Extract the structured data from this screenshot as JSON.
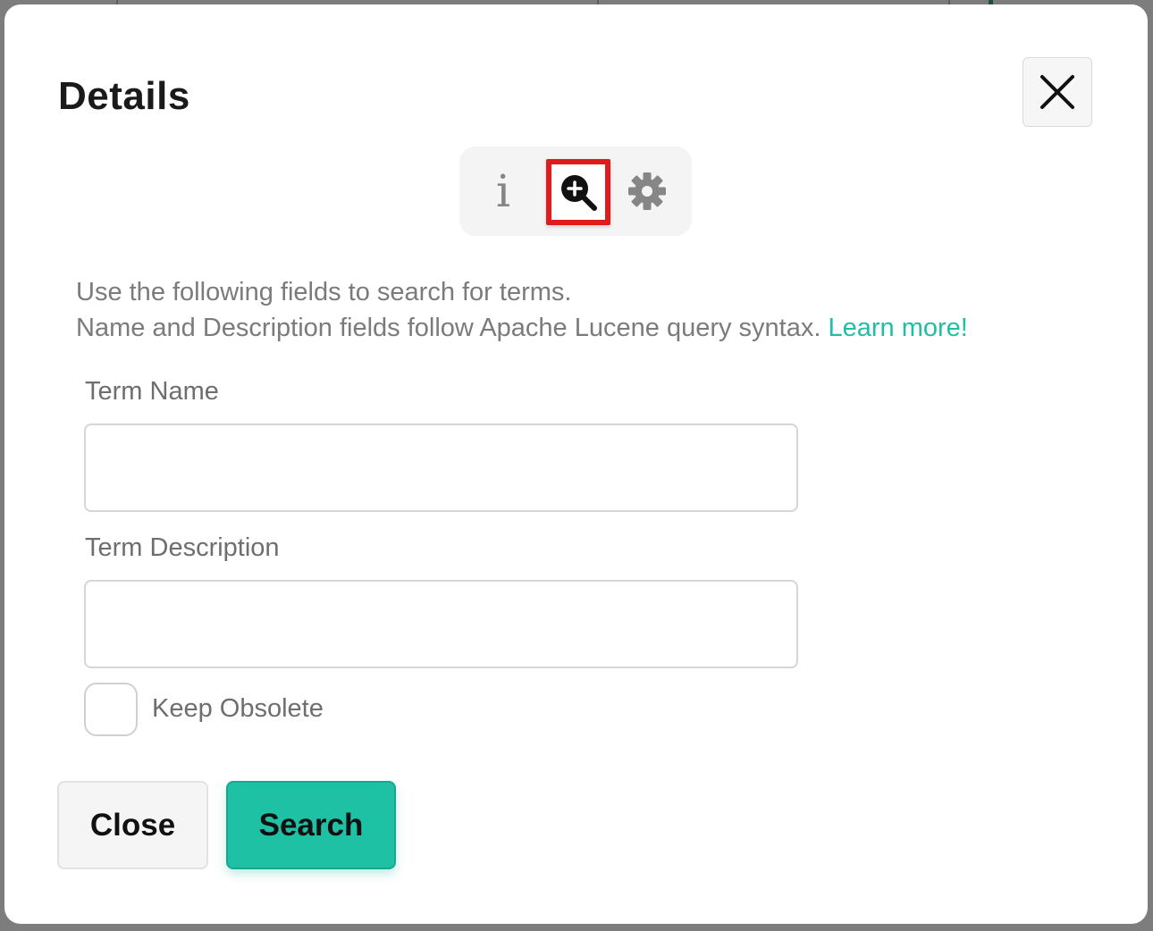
{
  "modal": {
    "title": "Details",
    "close_icon": "close-icon"
  },
  "tabs": [
    {
      "icon": "info-icon",
      "glyph": "i",
      "active": false
    },
    {
      "icon": "zoom-in-icon",
      "active": true
    },
    {
      "icon": "gear-icon",
      "active": false
    }
  ],
  "intro": {
    "line1": "Use the following fields to search for terms.",
    "line2": "Name and Description fields follow Apache Lucene query syntax.",
    "link": "Learn more!"
  },
  "form": {
    "term_name_label": "Term Name",
    "term_name_value": "",
    "term_description_label": "Term Description",
    "term_description_value": "",
    "keep_obsolete_label": "Keep Obsolete",
    "keep_obsolete_checked": false
  },
  "buttons": {
    "close_label": "Close",
    "search_label": "Search"
  },
  "colors": {
    "accent": "#1fc1a5",
    "link": "#1fbfa6",
    "highlight": "#e01b1b"
  }
}
